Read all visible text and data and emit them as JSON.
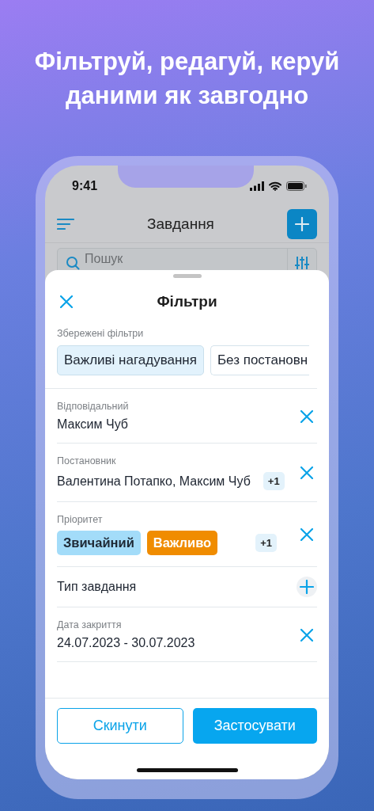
{
  "headline": "Фільтруй, редагуй, керуй даними як завгодно",
  "status_bar": {
    "time": "9:41"
  },
  "app_bar": {
    "title": "Завдання"
  },
  "search": {
    "placeholder": "Пошук"
  },
  "sheet": {
    "title": "Фільтри",
    "saved_filters": {
      "label": "Збережені фільтри",
      "chips": [
        {
          "label": "Важливі нагадування",
          "selected": true
        },
        {
          "label": "Без постановн",
          "selected": false
        }
      ]
    },
    "filters": [
      {
        "kind": "value",
        "label": "Відповідальний",
        "value": "Максим Чуб"
      },
      {
        "kind": "value",
        "label": "Постановник",
        "value": "Валентина Потапко, Максим Чуб",
        "extra": "+1"
      },
      {
        "kind": "tags",
        "label": "Пріоритет",
        "tags": [
          {
            "label": "Звичайний",
            "color": "#a3dcf9"
          },
          {
            "label": "Важливо",
            "color": "#f08c00"
          }
        ],
        "extra": "+1"
      },
      {
        "kind": "add",
        "label": "Тип завдання"
      },
      {
        "kind": "value",
        "label": "Дата закриття",
        "value": "24.07.2023 - 30.07.2023"
      }
    ],
    "buttons": [
      {
        "kind": "secondary",
        "label": "Скинути"
      },
      {
        "kind": "primary",
        "label": "Застосувати"
      }
    ]
  }
}
